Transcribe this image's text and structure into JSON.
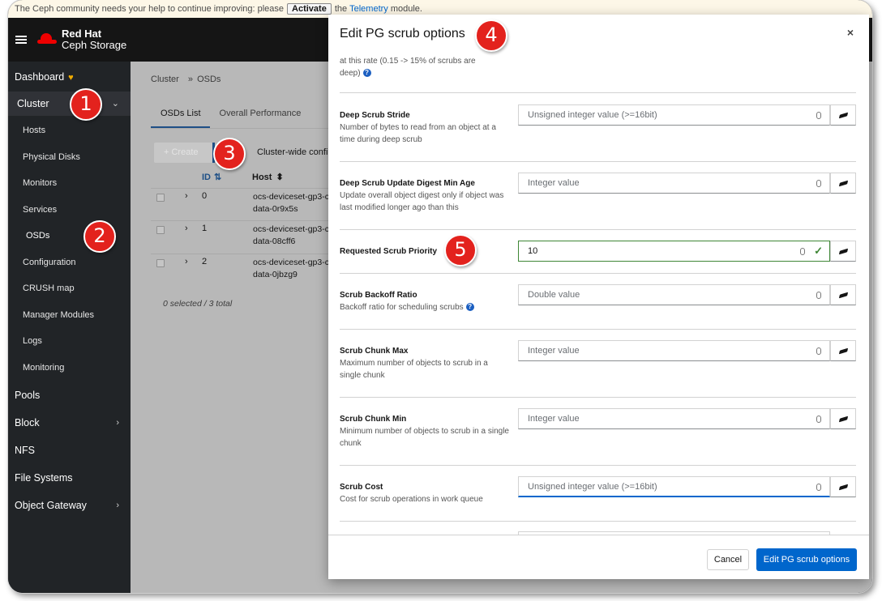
{
  "notification": {
    "text": "The Ceph community needs your help to continue improving: please",
    "activate_label": "Activate",
    "suffix_text": "the",
    "link_text": "Telemetry",
    "end_text": "module."
  },
  "header": {
    "brand_line1": "Red Hat",
    "brand_line2": "Ceph Storage"
  },
  "sidebar": {
    "dashboard": "Dashboard",
    "cluster": "Cluster",
    "hosts": "Hosts",
    "physical_disks": "Physical Disks",
    "monitors": "Monitors",
    "services": "Services",
    "osds": "OSDs",
    "configuration": "Configuration",
    "crush_map": "CRUSH map",
    "manager_modules": "Manager Modules",
    "logs": "Logs",
    "monitoring": "Monitoring",
    "pools": "Pools",
    "block": "Block",
    "nfs": "NFS",
    "file_systems": "File Systems",
    "object_gateway": "Object Gateway"
  },
  "main": {
    "breadcrumb_root": "Cluster",
    "breadcrumb_sep": "»",
    "breadcrumb_current": "OSDs",
    "tab_osds_list": "OSDs List",
    "tab_overall": "Overall Performance",
    "create_label": "+ Create",
    "cluster_wide_label": "Cluster-wide confi",
    "col_id": "ID",
    "col_host": "Host",
    "rows": [
      {
        "id": "0",
        "host1": "ocs-deviceset-gp3-c",
        "host2": "data-0r9x5s"
      },
      {
        "id": "1",
        "host1": "ocs-deviceset-gp3-c",
        "host2": "data-08cff6"
      },
      {
        "id": "2",
        "host1": "ocs-deviceset-gp3-c",
        "host2": "data-0jbzg9"
      }
    ],
    "total": "0 selected / 3 total"
  },
  "modal": {
    "title": "Edit PG scrub options",
    "close": "×",
    "partial_description": "at this rate (0.15 -> 15% of scrubs are deep)",
    "fields": [
      {
        "label": "Deep Scrub Stride",
        "desc": "Number of bytes to read from an object at a time during deep scrub",
        "value": "",
        "placeholder": "Unsigned integer value (>=16bit)"
      },
      {
        "label": "Deep Scrub Update Digest Min Age",
        "desc": "Update overall object digest only if object was last modified longer ago than this",
        "value": "",
        "placeholder": "Integer value"
      },
      {
        "label": "Requested Scrub Priority",
        "desc": "",
        "value": "10",
        "placeholder": ""
      },
      {
        "label": "Scrub Backoff Ratio",
        "desc": "Backoff ratio for scheduling scrubs",
        "value": "",
        "placeholder": "Double value"
      },
      {
        "label": "Scrub Chunk Max",
        "desc": "Maximum number of objects to scrub in a single chunk",
        "value": "",
        "placeholder": "Integer value"
      },
      {
        "label": "Scrub Chunk Min",
        "desc": "Minimum number of objects to scrub in a single chunk",
        "value": "",
        "placeholder": "Integer value"
      },
      {
        "label": "Scrub Cost",
        "desc": "Cost for scrub operations in work queue",
        "value": "",
        "placeholder": "Unsigned integer value (>=16bit)"
      }
    ],
    "cancel": "Cancel",
    "submit": "Edit PG scrub options"
  },
  "callouts": [
    "1",
    "2",
    "3",
    "4",
    "5"
  ],
  "colors": {
    "accent": "#0066cc",
    "valid": "#3e8635",
    "callout": "#e3221d",
    "brand": "#ee0000"
  }
}
